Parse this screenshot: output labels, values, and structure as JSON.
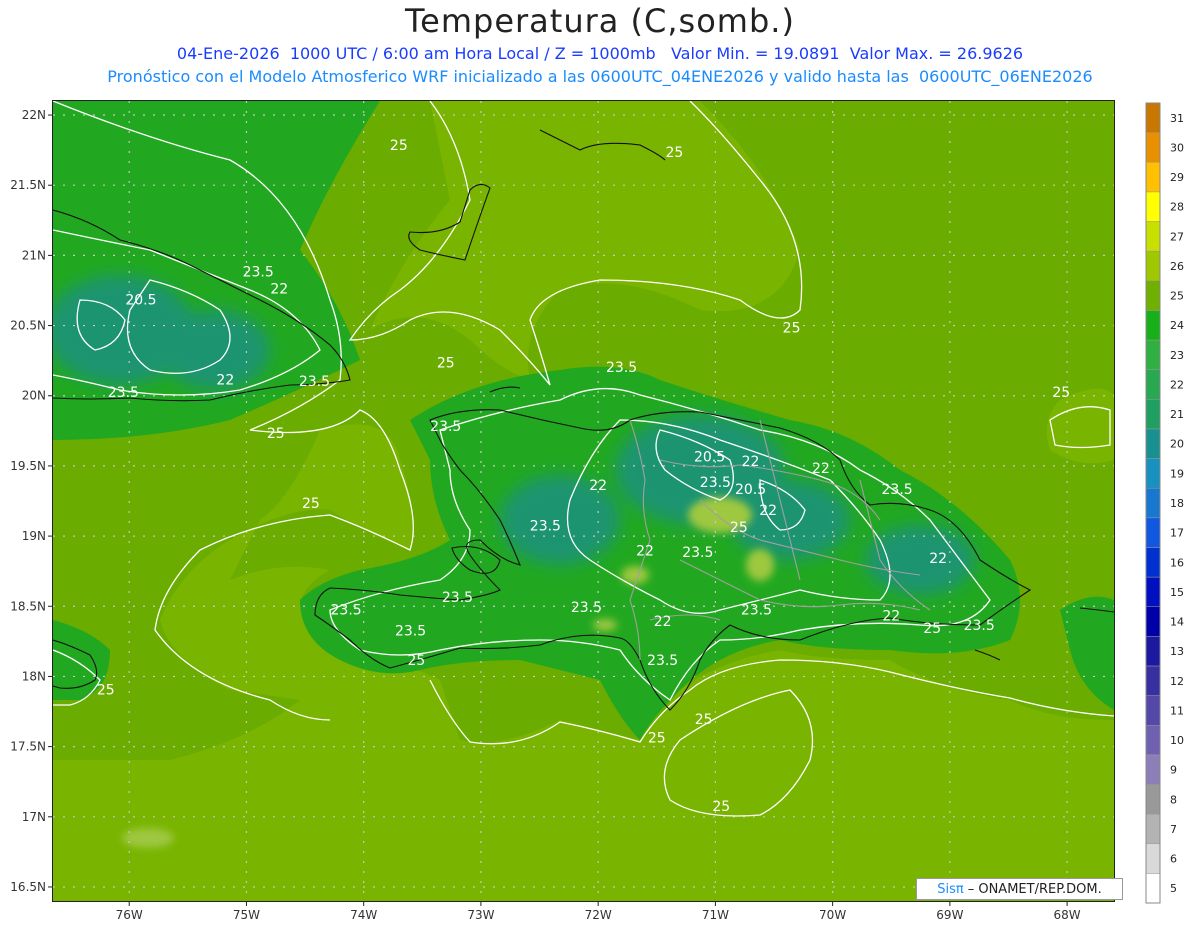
{
  "title": "Temperatura (C,somb.)",
  "subtitle1": "04-Ene-2026  1000 UTC / 6:00 am Hora Local / Z = 1000mb   Valor Min. = 19.0891  Valor Max. = 26.9626",
  "subtitle2": "Pronóstico con el Modelo Atmosferico WRF inicializado a las 0600UTC_04ENE2026 y valido hasta las  0600UTC_06ENE2026",
  "credit": {
    "brand": "Sisπ",
    "text": "– ONAMET/REP.DOM."
  },
  "axes": {
    "lat_labels": [
      "22N",
      "21.5N",
      "21N",
      "20.5N",
      "20N",
      "19.5N",
      "19N",
      "18.5N",
      "18N",
      "17.5N",
      "17N",
      "16.5N"
    ],
    "lat_values": [
      22,
      21.5,
      21,
      20.5,
      20,
      19.5,
      19,
      18.5,
      18,
      17.5,
      17,
      16.5
    ],
    "lon_labels": [
      "76W",
      "75W",
      "74W",
      "73W",
      "72W",
      "71W",
      "70W",
      "69W",
      "68W"
    ],
    "lon_values": [
      -76,
      -75,
      -74,
      -73,
      -72,
      -71,
      -70,
      -69,
      -68
    ],
    "lat_range": [
      16.4,
      22.1
    ],
    "lon_range": [
      -76.65,
      -67.6
    ]
  },
  "colorbar": {
    "labels": [
      "5",
      "6",
      "7",
      "8",
      "9",
      "10",
      "11",
      "12",
      "13",
      "14",
      "15",
      "16",
      "17",
      "18",
      "19",
      "20",
      "21",
      "22",
      "23",
      "24",
      "25",
      "26",
      "27",
      "28",
      "29",
      "30",
      "31"
    ],
    "colors": [
      "#ffffff",
      "#d9d9d9",
      "#b3b3b3",
      "#999999",
      "#8c7fb8",
      "#7060b0",
      "#5448a8",
      "#3830a0",
      "#1c18a0",
      "#0000a8",
      "#0010c0",
      "#0030d0",
      "#1058e0",
      "#1878d0",
      "#1890c0",
      "#189090",
      "#20a060",
      "#28a850",
      "#30b040",
      "#18b018",
      "#70b000",
      "#a0c800",
      "#c8e000",
      "#ffff00",
      "#ffc000",
      "#e89000",
      "#c87800"
    ],
    "colors_note": ""
  },
  "field_colors": {
    "sea": "#6aac00",
    "sea_warm": "#78b400",
    "land_mid": "#22a820",
    "land_cool": "#2aa84a",
    "land_cold": "#1f9470",
    "hot_patch": "#9ec840"
  },
  "contour_labels": [
    {
      "text": "25",
      "lon": -73.7,
      "lat": 21.75
    },
    {
      "text": "25",
      "lon": -71.35,
      "lat": 21.7
    },
    {
      "text": "23.5",
      "lon": -74.9,
      "lat": 20.85
    },
    {
      "text": "22",
      "lon": -74.72,
      "lat": 20.73
    },
    {
      "text": "20.5",
      "lon": -75.9,
      "lat": 20.65
    },
    {
      "text": "25",
      "lon": -70.35,
      "lat": 20.45
    },
    {
      "text": "25",
      "lon": -73.3,
      "lat": 20.2
    },
    {
      "text": "23.5",
      "lon": -71.8,
      "lat": 20.17
    },
    {
      "text": "22",
      "lon": -75.18,
      "lat": 20.08
    },
    {
      "text": "23.5",
      "lon": -74.42,
      "lat": 20.07
    },
    {
      "text": "23.5",
      "lon": -76.05,
      "lat": 19.99
    },
    {
      "text": "25",
      "lon": -68.05,
      "lat": 19.99
    },
    {
      "text": "25",
      "lon": -74.75,
      "lat": 19.7
    },
    {
      "text": "23.5",
      "lon": -73.3,
      "lat": 19.75
    },
    {
      "text": "20.5",
      "lon": -71.05,
      "lat": 19.53
    },
    {
      "text": "22",
      "lon": -70.7,
      "lat": 19.5
    },
    {
      "text": "22",
      "lon": -70.1,
      "lat": 19.45
    },
    {
      "text": "23.5",
      "lon": -71.0,
      "lat": 19.35
    },
    {
      "text": "20.5",
      "lon": -70.7,
      "lat": 19.3
    },
    {
      "text": "22",
      "lon": -72.0,
      "lat": 19.33
    },
    {
      "text": "23.5",
      "lon": -69.45,
      "lat": 19.3
    },
    {
      "text": "25",
      "lon": -74.45,
      "lat": 19.2
    },
    {
      "text": "22",
      "lon": -70.55,
      "lat": 19.15
    },
    {
      "text": "25",
      "lon": -70.8,
      "lat": 19.03
    },
    {
      "text": "23.5",
      "lon": -72.45,
      "lat": 19.04
    },
    {
      "text": "22",
      "lon": -71.6,
      "lat": 18.86
    },
    {
      "text": "23.5",
      "lon": -71.15,
      "lat": 18.85
    },
    {
      "text": "22",
      "lon": -69.1,
      "lat": 18.81
    },
    {
      "text": "23.5",
      "lon": -73.2,
      "lat": 18.53
    },
    {
      "text": "23.5",
      "lon": -74.15,
      "lat": 18.44
    },
    {
      "text": "23.5",
      "lon": -72.1,
      "lat": 18.46
    },
    {
      "text": "23.5",
      "lon": -70.65,
      "lat": 18.44
    },
    {
      "text": "22",
      "lon": -71.45,
      "lat": 18.36
    },
    {
      "text": "22",
      "lon": -69.5,
      "lat": 18.4
    },
    {
      "text": "25",
      "lon": -69.15,
      "lat": 18.31
    },
    {
      "text": "23.5",
      "lon": -68.75,
      "lat": 18.33
    },
    {
      "text": "23.5",
      "lon": -73.6,
      "lat": 18.29
    },
    {
      "text": "25",
      "lon": -73.55,
      "lat": 18.08
    },
    {
      "text": "23.5",
      "lon": -71.45,
      "lat": 18.08
    },
    {
      "text": "25",
      "lon": -76.2,
      "lat": 17.87
    },
    {
      "text": "25",
      "lon": -71.1,
      "lat": 17.66
    },
    {
      "text": "25",
      "lon": -71.5,
      "lat": 17.53
    },
    {
      "text": "25",
      "lon": -70.95,
      "lat": 17.04
    }
  ]
}
